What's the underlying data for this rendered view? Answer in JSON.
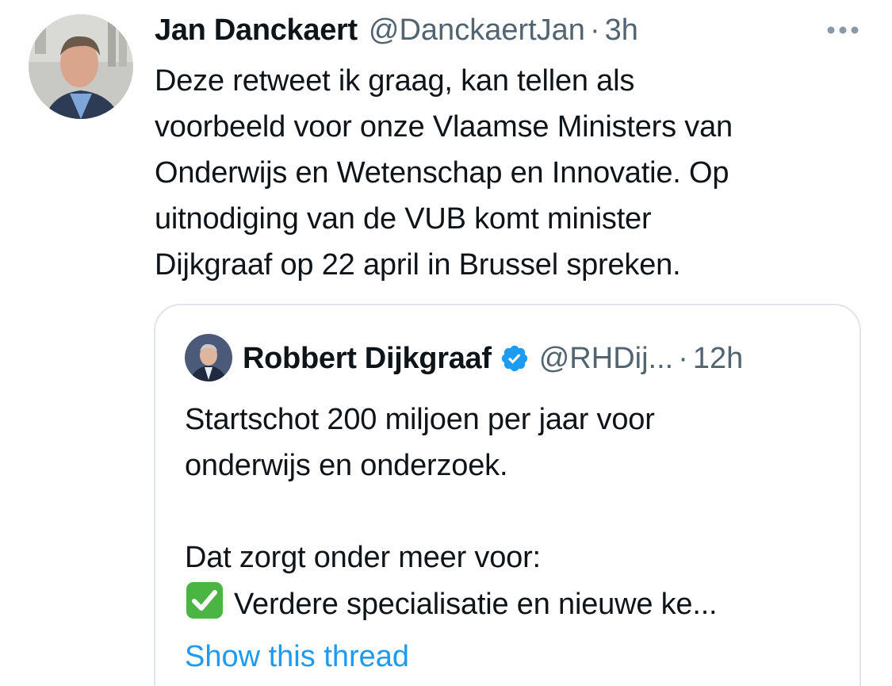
{
  "tweet": {
    "author_name": "Jan Danckaert",
    "author_handle": "@DanckaertJan",
    "separator": "·",
    "timestamp": "3h",
    "text": "Deze retweet ik graag, kan tellen als\nvoorbeeld voor onze Vlaamse Ministers van\nOnderwijs en Wetenschap en Innovatie. Op\nuitnodiging van de VUB komt minister\nDijkgraaf op 22 april in Brussel spreken.",
    "more_icon": "more-horizontal-icon"
  },
  "quoted_tweet": {
    "author_name": "Robbert Dijkgraaf",
    "verified_icon": "verified-badge-icon",
    "author_handle": "@RHDij...",
    "separator": "·",
    "timestamp": "12h",
    "text_part1": "Startschot 200 miljoen per jaar voor\nonderwijs en onderzoek.\n\nDat zorgt onder meer voor:\n",
    "check_icon": "check-mark-button-icon",
    "text_part2": "Verdere specialisatie en nieuwe ke...",
    "show_thread_label": "Show this thread"
  },
  "colors": {
    "text_primary": "#0f1419",
    "text_secondary": "#536471",
    "link": "#1d9bf0",
    "border": "#e1e6ea",
    "verified": "#1d9bf0",
    "check_green": "#4bb543"
  }
}
